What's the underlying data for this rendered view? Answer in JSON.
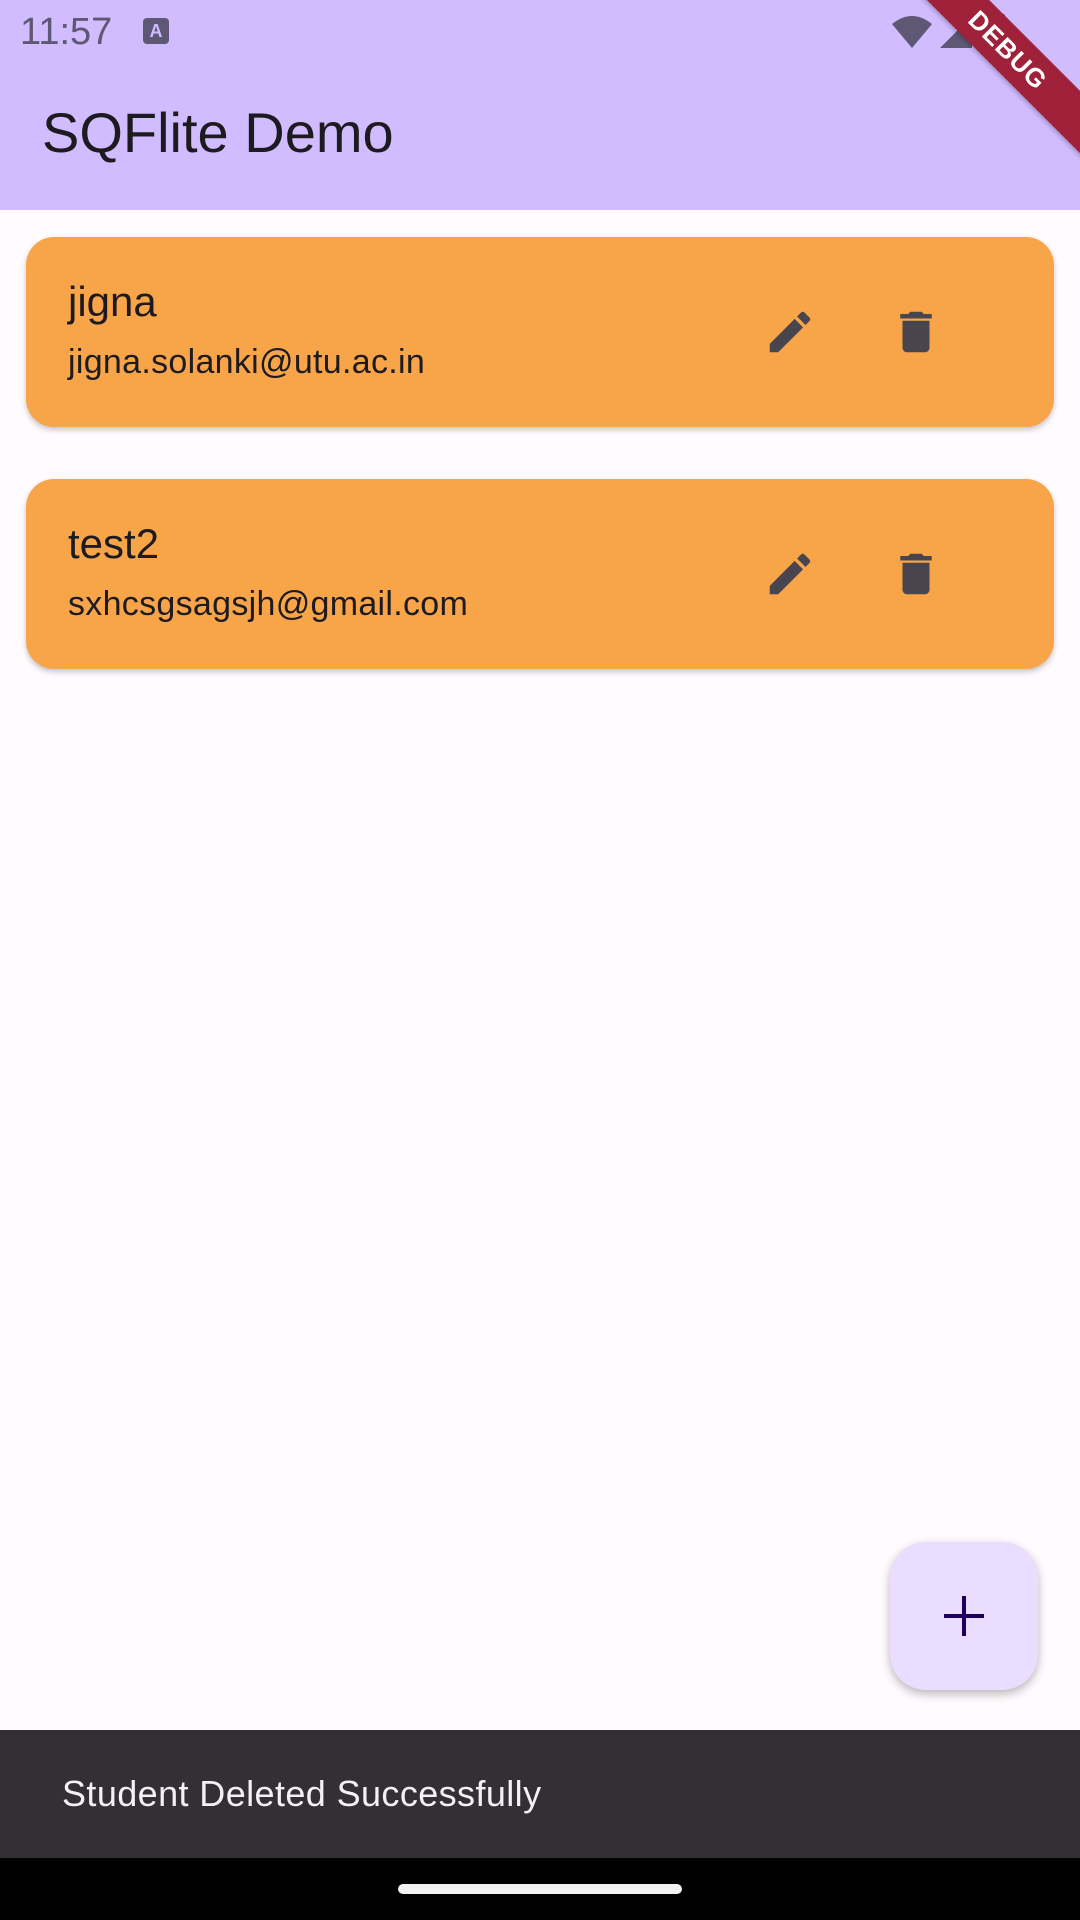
{
  "status_bar": {
    "time": "11:57",
    "notification_icon": "keyboard-notification-icon",
    "icons": [
      "wifi-icon",
      "signal-icon",
      "battery-icon"
    ]
  },
  "app_bar": {
    "title": "SQFlite Demo",
    "background": "#d0bcff"
  },
  "debug_banner": {
    "label": "DEBUG"
  },
  "students": [
    {
      "name": "jigna",
      "email": "jigna.solanki@utu.ac.in",
      "actions": [
        "edit-icon",
        "delete-icon"
      ]
    },
    {
      "name": "test2",
      "email": "sxhcsgsagsjh@gmail.com",
      "actions": [
        "edit-icon",
        "delete-icon"
      ]
    }
  ],
  "card_color": "#f8a54a",
  "fab": {
    "icon": "plus-icon",
    "background": "#eaddff"
  },
  "snackbar": {
    "message": "Student Deleted Successfully"
  }
}
